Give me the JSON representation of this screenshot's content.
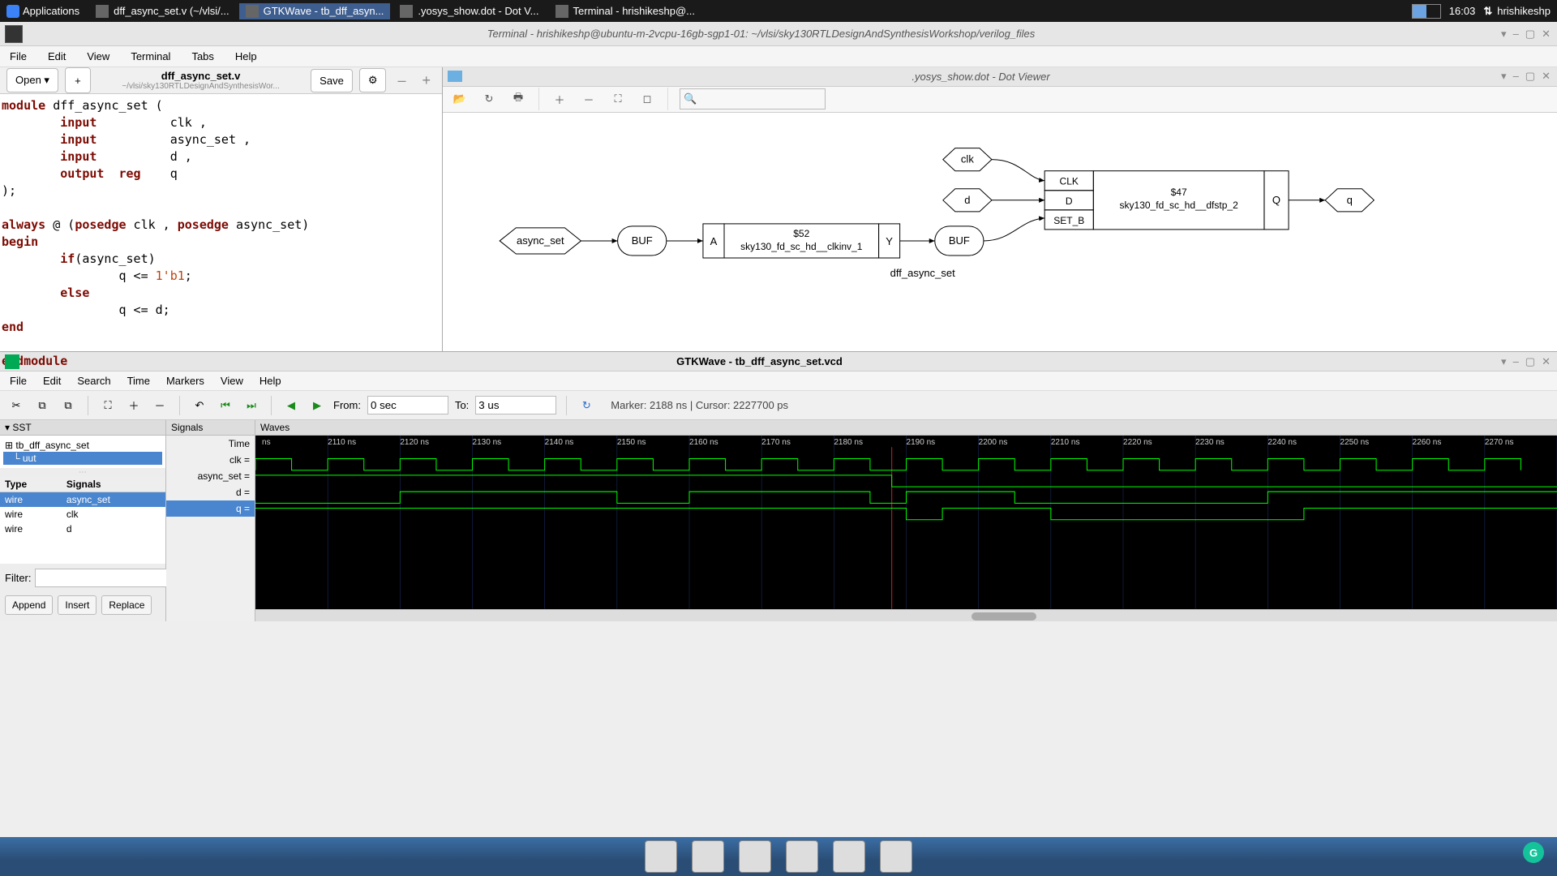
{
  "panel": {
    "apps_label": "Applications",
    "tasks": [
      {
        "label": "dff_async_set.v (~/vlsi/..."
      },
      {
        "label": "GTKWave - tb_dff_asyn...",
        "active": true
      },
      {
        "label": ".yosys_show.dot - Dot V..."
      },
      {
        "label": "Terminal - hrishikeshp@..."
      }
    ],
    "clock": "16:03",
    "user": "hrishikeshp"
  },
  "terminal": {
    "title": "Terminal - hrishikeshp@ubuntu-m-2vcpu-16gb-sgp1-01: ~/vlsi/sky130RTLDesignAndSynthesisWorkshop/verilog_files",
    "menus": [
      "File",
      "Edit",
      "View",
      "Terminal",
      "Tabs",
      "Help"
    ]
  },
  "editor": {
    "open_label": "Open ▾",
    "save_label": "Save",
    "filename": "dff_async_set.v",
    "filepath": "~/vlsi/sky130RTLDesignAndSynthesisWor..."
  },
  "code": {
    "l1": "module dff_async_set (",
    "l2a": "input",
    "l2b": "          clk ,",
    "l3a": "input",
    "l3b": "          async_set ,",
    "l4a": "input",
    "l4b": "          d ,",
    "l5a": "output  reg",
    "l5b": "    q",
    "l6": ");",
    "l7a": "always",
    "l7b": " @ (",
    "l7c": "posedge",
    "l7d": " clk , ",
    "l7e": "posedge",
    "l7f": " async_set)",
    "l8": "begin",
    "l9a": "        if",
    "l9b": "(async_set)",
    "l10a": "                q <= ",
    "l10b": "1'b1",
    "l10c": ";",
    "l11": "        else",
    "l12": "                q <= d;",
    "l13": "end",
    "l14": "endmodule"
  },
  "dotviewer": {
    "title": ".yosys_show.dot - Dot Viewer",
    "graph": {
      "async_set": "async_set",
      "buf1": "BUF",
      "inv_a": "A",
      "inv_id": "$52",
      "inv_cell": "sky130_fd_sc_hd__clkinv_1",
      "inv_y": "Y",
      "buf2": "BUF",
      "module_label": "dff_async_set",
      "clk": "clk",
      "d": "d",
      "ff_clk": "CLK",
      "ff_d": "D",
      "ff_setb": "SET_B",
      "ff_id": "$47",
      "ff_cell": "sky130_fd_sc_hd__dfstp_2",
      "ff_q": "Q",
      "q": "q"
    }
  },
  "gtkwave": {
    "title": "GTKWave - tb_dff_async_set.vcd",
    "menus": [
      "File",
      "Edit",
      "Search",
      "Time",
      "Markers",
      "View",
      "Help"
    ],
    "from_label": "From:",
    "from_val": "0 sec",
    "to_label": "To:",
    "to_val": "3 us",
    "status": "Marker: 2188 ns   |   Cursor: 2227700 ps",
    "sst_label": "▾ SST",
    "tree": {
      "root": "tb_dff_async_set",
      "child": "uut"
    },
    "cols": {
      "type": "Type",
      "signals": "Signals"
    },
    "sigs": [
      {
        "type": "wire",
        "name": "async_set",
        "sel": true
      },
      {
        "type": "wire",
        "name": "clk"
      },
      {
        "type": "wire",
        "name": "d"
      }
    ],
    "filter_label": "Filter:",
    "btns": {
      "append": "Append",
      "insert": "Insert",
      "replace": "Replace"
    },
    "sig_hdr": "Signals",
    "wave_hdr": "Waves",
    "sig_rows": {
      "time": "Time",
      "clk": "clk =",
      "async": "async_set =",
      "d": "d =",
      "q": "q ="
    },
    "timescale": [
      "ns",
      "2110 ns",
      "2120 ns",
      "2130 ns",
      "2140 ns",
      "2150 ns",
      "2160 ns",
      "2170 ns",
      "2180 ns",
      "2190 ns",
      "2200 ns",
      "2210 ns",
      "2220 ns",
      "2230 ns",
      "2240 ns",
      "2250 ns",
      "2260 ns",
      "2270 ns"
    ]
  },
  "chart_data": {
    "type": "waveform",
    "x_unit": "ns",
    "x_range": [
      2100,
      2280
    ],
    "marker_ns": 2188,
    "cursor_ps": 2227700,
    "signals": [
      {
        "name": "clk",
        "period_ns": 10,
        "duty": 0.5,
        "phase_start_ns": 2100
      },
      {
        "name": "async_set",
        "transitions": [
          [
            2100,
            1
          ],
          [
            2188,
            0
          ],
          [
            2280,
            0
          ]
        ]
      },
      {
        "name": "d",
        "transitions": [
          [
            2100,
            0
          ],
          [
            2120,
            1
          ],
          [
            2150,
            0
          ],
          [
            2160,
            1
          ],
          [
            2185,
            0
          ],
          [
            2190,
            1
          ],
          [
            2205,
            0
          ],
          [
            2240,
            1
          ],
          [
            2280,
            1
          ]
        ]
      },
      {
        "name": "q",
        "transitions": [
          [
            2100,
            1
          ],
          [
            2120,
            1
          ],
          [
            2190,
            0
          ],
          [
            2195,
            1
          ],
          [
            2210,
            0
          ],
          [
            2245,
            1
          ],
          [
            2280,
            1
          ]
        ]
      }
    ]
  }
}
